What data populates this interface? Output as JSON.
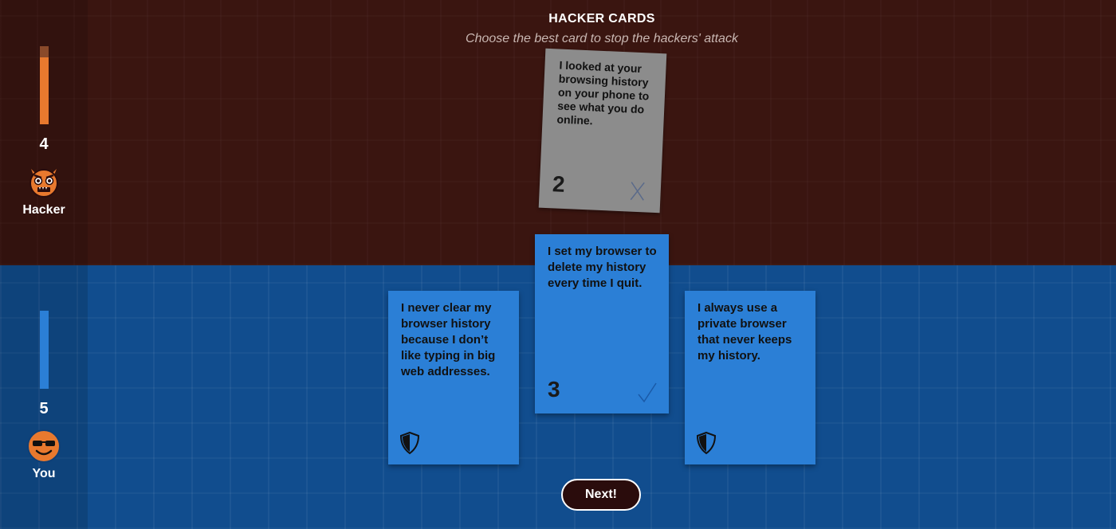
{
  "header": {
    "title": "HACKER CARDS",
    "subtitle": "Choose the best card to stop the hackers' attack"
  },
  "hacker": {
    "score": "4",
    "label": "Hacker",
    "avatar_icon": "devil-face-icon",
    "meter_level": 0.86,
    "color": "#e8792e"
  },
  "player": {
    "score": "5",
    "label": "You",
    "avatar_icon": "sunglasses-smiley-icon",
    "meter_level": 1.0,
    "color": "#2b7fd6"
  },
  "hacker_card": {
    "text": "I looked at your browsing history on your phone to see what you do online.",
    "number": "2",
    "mark_icon": "x-mark-icon"
  },
  "user_cards": [
    {
      "text": "I never clear my browser history because I don’t like typing in big web addresses.",
      "icon": "shield-icon"
    },
    {
      "text": "I set my browser to delete my history every time I quit.",
      "number": "3",
      "icon": "checkmark-icon"
    },
    {
      "text": "I always use a private browser that never keeps my history.",
      "icon": "shield-icon"
    }
  ],
  "next_button": {
    "label": "Next!"
  }
}
